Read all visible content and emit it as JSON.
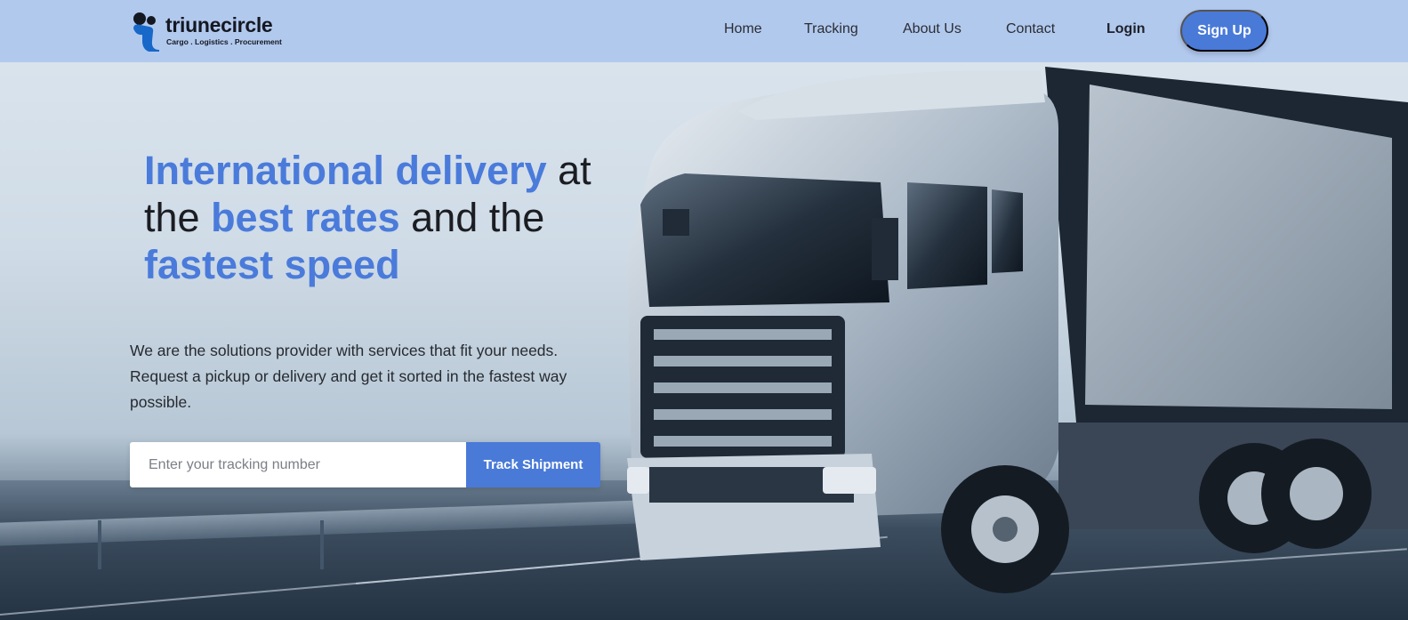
{
  "brand": {
    "name": "triunecircle",
    "tagline": "Cargo . Logistics . Procurement"
  },
  "nav": {
    "links": [
      "Home",
      "Tracking",
      "About Us",
      "Contact"
    ],
    "login_label": "Login",
    "signup_label": "Sign Up"
  },
  "hero": {
    "headline": {
      "part1": "International delivery",
      "part2": " at",
      "part3": "the ",
      "part4": "best rates",
      "part5": " and the",
      "part6": "fastest speed"
    },
    "description": "We are the solutions provider with services that fit your needs. Request a pickup or delivery and get it sorted in the fastest way possible.",
    "tracking": {
      "placeholder": "Enter your tracking number",
      "button_label": "Track Shipment"
    }
  },
  "colors": {
    "accent": "#4a7ad8",
    "nav_background": "#b2c9ee",
    "heading_dark": "#1b1d22"
  },
  "images": {
    "hero_background": "truck on highway"
  }
}
